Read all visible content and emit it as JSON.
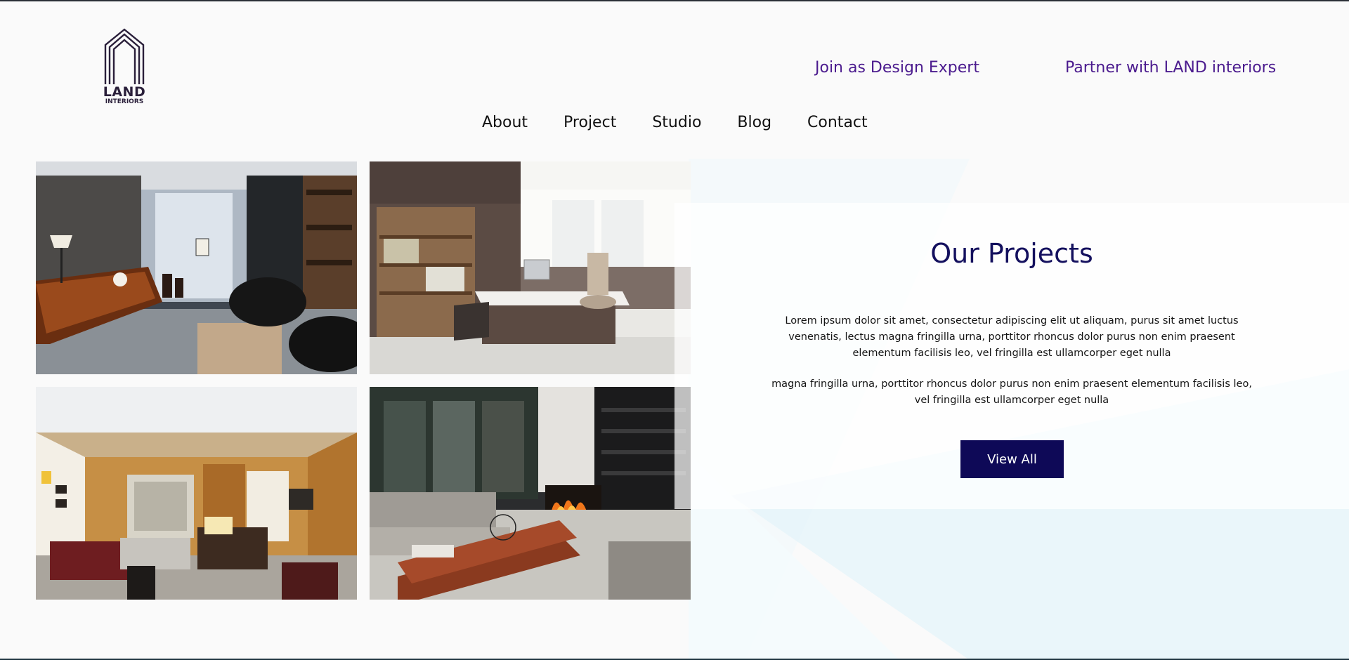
{
  "brand": {
    "name": "LAND",
    "sub": "INTERIORS"
  },
  "header": {
    "join_link": "Join as Design Expert",
    "partner_link": "Partner with LAND interiors"
  },
  "nav": {
    "items": [
      "About",
      "Project",
      "Studio",
      "Blog",
      "Contact"
    ]
  },
  "projects": {
    "title": "Our Projects",
    "paragraph1": "Lorem ipsum dolor sit amet, consectetur adipiscing elit ut aliquam, purus sit amet luctus venenatis, lectus magna fringilla urna, porttitor rhoncus dolor purus non enim praesent elementum facilisis leo, vel fringilla est ullamcorper eget nulla",
    "paragraph2": "magna fringilla urna, porttitor rhoncus dolor purus non enim praesent elementum facilisis leo, vel fringilla est ullamcorper eget nulla",
    "button_label": "View All"
  },
  "gallery": {
    "images": [
      "office-interior-photo",
      "study-office-photo",
      "reception-lounge-photo",
      "living-room-fireplace-photo"
    ]
  },
  "colors": {
    "accent": "#0e0957",
    "link": "#4b1b8e",
    "title": "#14105e"
  }
}
